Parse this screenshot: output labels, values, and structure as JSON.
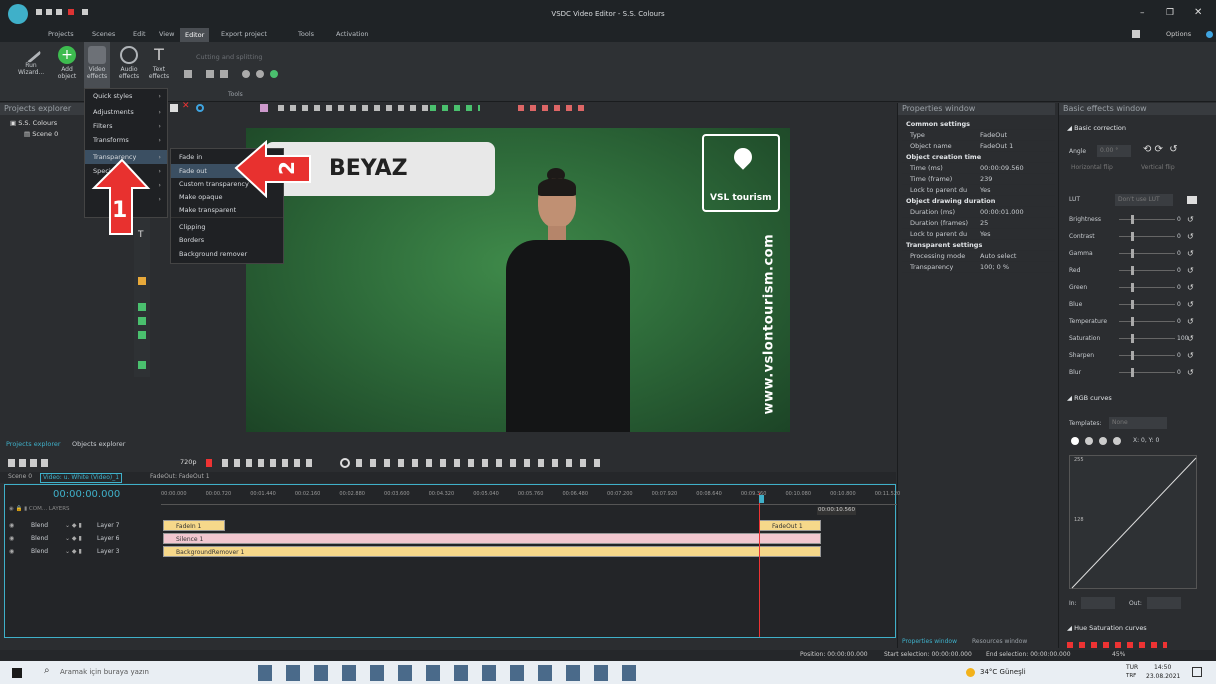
{
  "window": {
    "title": "VSDC Video Editor - S.S. Colours",
    "options": "Options"
  },
  "menu": [
    "Projects",
    "Scenes",
    "Edit",
    "View",
    "Editor",
    "Export project",
    "Tools",
    "Activation"
  ],
  "ribbon": {
    "buttons": [
      {
        "label": "Run Wizard...",
        "icon": "wand-icon"
      },
      {
        "label": "Add object",
        "icon": "add-icon"
      },
      {
        "label": "Video effects",
        "icon": "video-effects-icon"
      },
      {
        "label": "Audio effects",
        "icon": "audio-effects-icon"
      },
      {
        "label": "Text effects",
        "icon": "text-effects-icon"
      }
    ],
    "cutting": "Cutting and splitting",
    "tools_label": "Tools",
    "quick_styles": "Quick styles"
  },
  "left_panel": {
    "title": "Projects explorer",
    "project": "S.S. Colours",
    "scene": "Scene 0",
    "tabs": [
      "Projects explorer",
      "Objects explorer"
    ]
  },
  "menus": {
    "main": [
      {
        "label": "Quick styles"
      },
      {
        "label": "Adjustments"
      },
      {
        "label": "Filters"
      },
      {
        "label": "Transforms"
      },
      {
        "label": "Transparency"
      },
      {
        "label": "Special FX"
      }
    ],
    "transparency": [
      "Fade in",
      "Fade out",
      "Custom transparency",
      "Make opaque",
      "Make transparent",
      "Clipping",
      "Borders",
      "Background remover"
    ]
  },
  "annotations": {
    "arrow1": "1",
    "arrow2": "2",
    "banner": "BEYAZ"
  },
  "video": {
    "logo_text": "VSL tourism",
    "site": "www.vslontourism.com"
  },
  "properties": {
    "title": "Properties window",
    "rows": [
      {
        "t": "sec",
        "k": "Common settings",
        "v": ""
      },
      {
        "k": "Type",
        "v": "FadeOut"
      },
      {
        "k": "Object name",
        "v": "FadeOut 1"
      },
      {
        "t": "sec",
        "k": "Object creation time",
        "v": ""
      },
      {
        "k": "Time (ms)",
        "v": "00:00:09.560"
      },
      {
        "k": "Time (frame)",
        "v": "239"
      },
      {
        "k": "Lock to parent du",
        "v": "Yes"
      },
      {
        "t": "sec",
        "k": "Object drawing duration",
        "v": ""
      },
      {
        "k": "Duration (ms)",
        "v": "00:00:01.000"
      },
      {
        "k": "Duration (frames)",
        "v": "25"
      },
      {
        "k": "Lock to parent du",
        "v": "Yes"
      },
      {
        "t": "sec",
        "k": "Transparent settings",
        "v": ""
      },
      {
        "k": "Processing mode",
        "v": "Auto select"
      },
      {
        "k": "Transparency",
        "v": "100; 0 %"
      }
    ],
    "tabs": [
      "Properties window",
      "Resources window"
    ]
  },
  "effects": {
    "title": "Basic effects window",
    "section": "Basic correction",
    "angle_label": "Angle",
    "angle_value": "0.00 °",
    "hflip": "Horizontal flip",
    "vflip": "Vertical flip",
    "lut_label": "LUT",
    "lut_value": "Don't use LUT",
    "sliders": [
      {
        "label": "Brightness",
        "value": "0"
      },
      {
        "label": "Contrast",
        "value": "0"
      },
      {
        "label": "Gamma",
        "value": "0"
      },
      {
        "label": "Red",
        "value": "0"
      },
      {
        "label": "Green",
        "value": "0"
      },
      {
        "label": "Blue",
        "value": "0"
      },
      {
        "label": "Temperature",
        "value": "0"
      },
      {
        "label": "Saturation",
        "value": "100"
      },
      {
        "label": "Sharpen",
        "value": "0"
      },
      {
        "label": "Blur",
        "value": "0"
      }
    ],
    "rgb_curves": "RGB curves",
    "templates_label": "Templates:",
    "templates_value": "None",
    "coords": "X: 0, Y: 0",
    "curve_top": "255",
    "curve_mid": "128",
    "in_label": "In:",
    "out_label": "Out:",
    "hue_curves": "Hue Saturation curves"
  },
  "transport": {
    "resolution": "720p"
  },
  "timeline": {
    "scene_tab": "Scene 0",
    "video_tab": "Video: u. White (Video)_1",
    "fade_tab": "FadeOut: FadeOut 1",
    "timecode": "00:00:00.000",
    "ruler": [
      "00:00.000",
      "00:00.720",
      "00:01.440",
      "00:02.160",
      "00:02.880",
      "00:03.600",
      "00:04.320",
      "00:05.040",
      "00:05.760",
      "00:06.480",
      "00:07.200",
      "00:07.920",
      "00:08.640",
      "00:09.360",
      "00:10.080",
      "00:10.800",
      "00:11.520"
    ],
    "cursor_time": "00:00:10.560",
    "header": "COM... LAYERS",
    "layers": [
      {
        "blend": "Blend",
        "name": "Layer 7"
      },
      {
        "blend": "Blend",
        "name": "Layer 6"
      },
      {
        "blend": "Blend",
        "name": "Layer 3"
      }
    ],
    "clips": [
      {
        "label": "FadeIn 1"
      },
      {
        "label": "FadeOut 1"
      },
      {
        "label": "Silence 1"
      },
      {
        "label": "BackgroundRemover 1"
      }
    ]
  },
  "status": {
    "position": "Position:  00:00:00.000",
    "start": "Start selection:  00:00:00.000",
    "end": "End selection:  00:00:00.000",
    "zoom": "45%"
  },
  "taskbar": {
    "search": "Aramak için buraya yazın",
    "weather": "34°C  Güneşli",
    "lang": "TUR",
    "lang2": "TRF",
    "time": "14:50",
    "date": "23.08.2021"
  },
  "colors": {
    "accent": "#3fb0c9",
    "green_screen": "#2e6b3a",
    "arrow": "#e8312f",
    "clip_yellow": "#f6d88a",
    "clip_pink": "#f2c7cf"
  }
}
